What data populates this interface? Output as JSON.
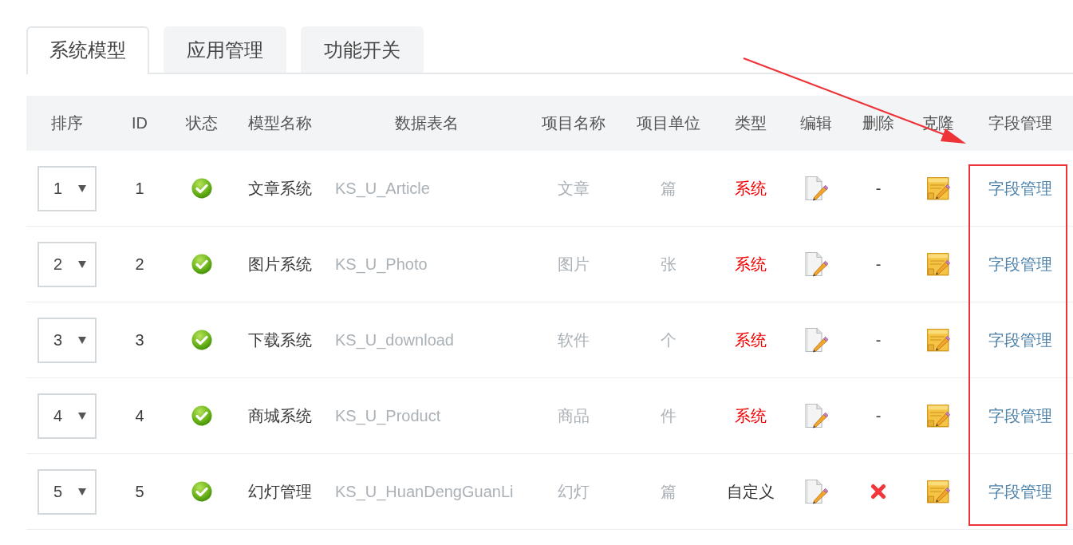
{
  "tabs": [
    {
      "label": "系统模型",
      "selected": true
    },
    {
      "label": "应用管理",
      "selected": false
    },
    {
      "label": "功能开关",
      "selected": false
    }
  ],
  "table": {
    "columns": [
      "排序",
      "ID",
      "状态",
      "模型名称",
      "数据表名",
      "项目名称",
      "项目单位",
      "类型",
      "编辑",
      "删除",
      "克隆",
      "字段管理"
    ],
    "rows": [
      {
        "order": "1",
        "id": "1",
        "enabled": true,
        "name": "文章系统",
        "table_name": "KS_U_Article",
        "item_name": "文章",
        "item_unit": "篇",
        "type": "系统",
        "builtin": true,
        "delete": {
          "kind": "dash",
          "text": "-"
        },
        "fields_link": "字段管理"
      },
      {
        "order": "2",
        "id": "2",
        "enabled": true,
        "name": "图片系统",
        "table_name": "KS_U_Photo",
        "item_name": "图片",
        "item_unit": "张",
        "type": "系统",
        "builtin": true,
        "delete": {
          "kind": "dash",
          "text": "-"
        },
        "fields_link": "字段管理"
      },
      {
        "order": "3",
        "id": "3",
        "enabled": true,
        "name": "下载系统",
        "table_name": "KS_U_download",
        "item_name": "软件",
        "item_unit": "个",
        "type": "系统",
        "builtin": true,
        "delete": {
          "kind": "dash",
          "text": "-"
        },
        "fields_link": "字段管理"
      },
      {
        "order": "4",
        "id": "4",
        "enabled": true,
        "name": "商城系统",
        "table_name": "KS_U_Product",
        "item_name": "商品",
        "item_unit": "件",
        "type": "系统",
        "builtin": true,
        "delete": {
          "kind": "dash",
          "text": "-"
        },
        "fields_link": "字段管理"
      },
      {
        "order": "5",
        "id": "5",
        "enabled": true,
        "name": "幻灯管理",
        "table_name": "KS_U_HuanDengGuanLi",
        "item_name": "幻灯",
        "item_unit": "篇",
        "type": "自定义",
        "builtin": false,
        "delete": {
          "kind": "icon"
        },
        "fields_link": "字段管理"
      }
    ]
  }
}
